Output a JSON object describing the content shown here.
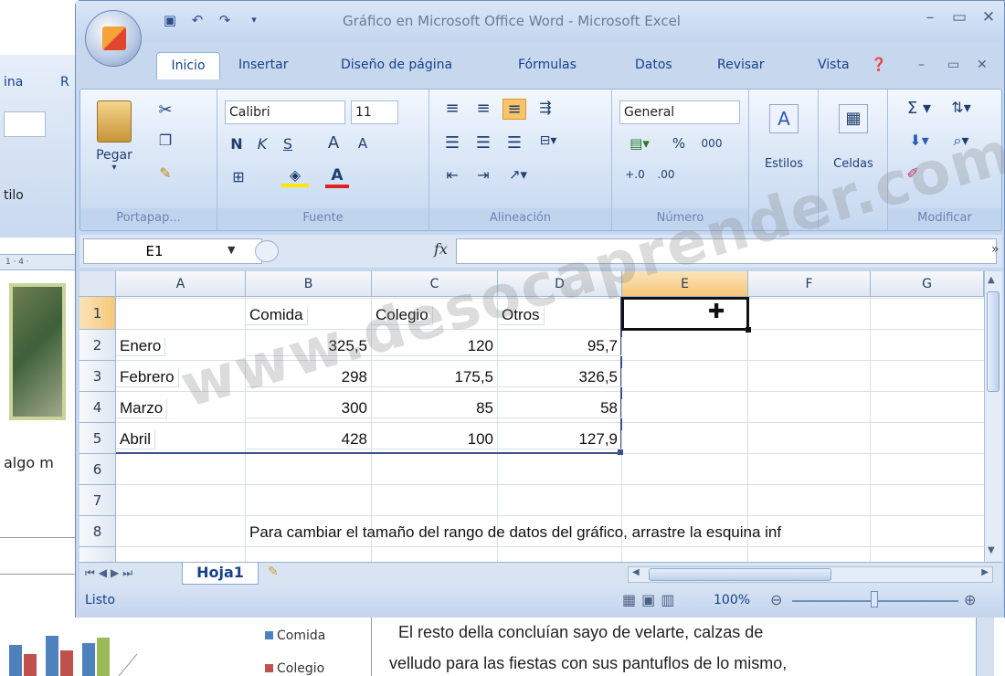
{
  "word": {
    "tabs": [
      "ina",
      "R"
    ],
    "style_label": "tilo",
    "ruler": "1 · 4 ·",
    "doc_fragment": "algo m",
    "legend": [
      "Comida",
      "Colegio"
    ],
    "legend_colors": [
      "#4f81bd",
      "#c0504d"
    ],
    "body_lines": [
      "El resto della concluían sayo de velarte, calzas de",
      "velludo para las fiestas con sus pantuflos de lo mismo,"
    ]
  },
  "excel": {
    "title": "Gráfico en Microsoft Office Word - Microsoft Excel",
    "tabs": [
      "Inicio",
      "Insertar",
      "Diseño de página",
      "Fórmulas",
      "Datos",
      "Revisar",
      "Vista"
    ],
    "active_tab": "Inicio",
    "ribbon": {
      "portapapeles": {
        "paste": "Pegar",
        "label": "Portapap..."
      },
      "fuente": {
        "font": "Calibri",
        "size": "11",
        "bold": "N",
        "italic": "K",
        "underline": "S",
        "grow": "A",
        "shrink": "A",
        "label": "Fuente"
      },
      "alineacion": {
        "label": "Alineación"
      },
      "numero": {
        "format": "General",
        "percent": "%",
        "thousands": "000",
        "label": "Número"
      },
      "estilos": {
        "label": "Estilos"
      },
      "celdas": {
        "label": "Celdas"
      },
      "modificar": {
        "label": "Modificar"
      }
    },
    "namebox": "E1",
    "fx": "fx",
    "columns": [
      "A",
      "B",
      "C",
      "D",
      "E",
      "F",
      "G"
    ],
    "rows": [
      "1",
      "2",
      "3",
      "4",
      "5",
      "6",
      "7",
      "8"
    ],
    "cells": {
      "b1": "Comida",
      "c1": "Colegio",
      "d1": "Otros",
      "a2": "Enero",
      "b2": "325,5",
      "c2": "120",
      "d2": "95,7",
      "a3": "Febrero",
      "b3": "298",
      "c3": "175,5",
      "d3": "326,5",
      "a4": "Marzo",
      "b4": "300",
      "c4": "85",
      "d4": "58",
      "a5": "Abril",
      "b5": "428",
      "c5": "100",
      "d5": "127,9",
      "b8": "Para cambiar el tamaño del rango de datos del gráfico, arrastre la esquina inf"
    },
    "sheet_tab": "Hoja1",
    "status": "Listo",
    "zoom": "100%"
  },
  "watermark": "www.desocaprender.com"
}
